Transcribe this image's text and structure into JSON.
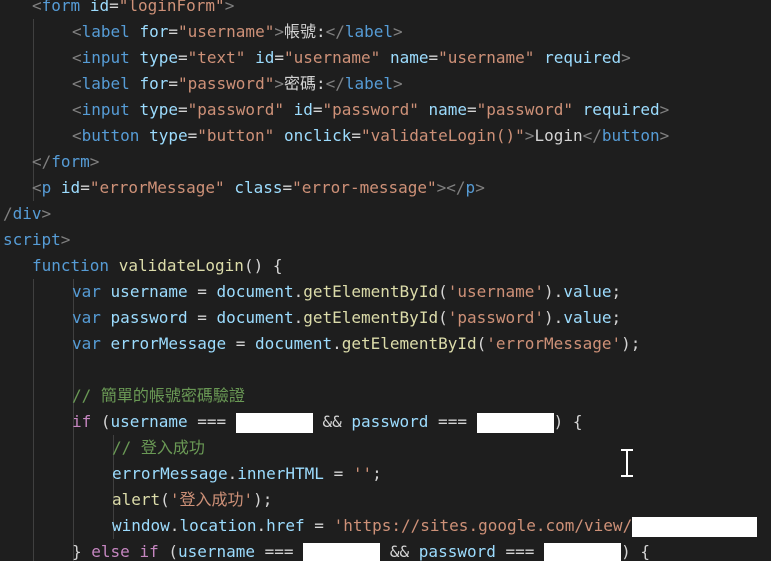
{
  "editor": {
    "language": "html",
    "redaction_color": "#ffffff",
    "cursor_icon": "text-cursor-icon",
    "lines": [
      {
        "indent": 32,
        "tokens": [
          {
            "t": "<",
            "c": "punc"
          },
          {
            "t": "form",
            "c": "tag"
          },
          {
            "t": " "
          },
          {
            "t": "id",
            "c": "attr"
          },
          {
            "t": "=",
            "c": "text"
          },
          {
            "t": "\"loginForm\"",
            "c": "str"
          },
          {
            "t": ">",
            "c": "punc"
          }
        ]
      },
      {
        "indent": 72,
        "tokens": [
          {
            "t": "<",
            "c": "punc"
          },
          {
            "t": "label",
            "c": "tag"
          },
          {
            "t": " "
          },
          {
            "t": "for",
            "c": "attr"
          },
          {
            "t": "=",
            "c": "text"
          },
          {
            "t": "\"username\"",
            "c": "str"
          },
          {
            "t": ">",
            "c": "punc"
          },
          {
            "t": "帳號:",
            "c": "text"
          },
          {
            "t": "</",
            "c": "punc"
          },
          {
            "t": "label",
            "c": "tag"
          },
          {
            "t": ">",
            "c": "punc"
          }
        ]
      },
      {
        "indent": 72,
        "tokens": [
          {
            "t": "<",
            "c": "punc"
          },
          {
            "t": "input",
            "c": "tag"
          },
          {
            "t": " "
          },
          {
            "t": "type",
            "c": "attr"
          },
          {
            "t": "=",
            "c": "text"
          },
          {
            "t": "\"text\"",
            "c": "str"
          },
          {
            "t": " "
          },
          {
            "t": "id",
            "c": "attr"
          },
          {
            "t": "=",
            "c": "text"
          },
          {
            "t": "\"username\"",
            "c": "str"
          },
          {
            "t": " "
          },
          {
            "t": "name",
            "c": "attr"
          },
          {
            "t": "=",
            "c": "text"
          },
          {
            "t": "\"username\"",
            "c": "str"
          },
          {
            "t": " "
          },
          {
            "t": "required",
            "c": "attr"
          },
          {
            "t": ">",
            "c": "punc"
          }
        ]
      },
      {
        "indent": 72,
        "tokens": [
          {
            "t": "<",
            "c": "punc"
          },
          {
            "t": "label",
            "c": "tag"
          },
          {
            "t": " "
          },
          {
            "t": "for",
            "c": "attr"
          },
          {
            "t": "=",
            "c": "text"
          },
          {
            "t": "\"password\"",
            "c": "str"
          },
          {
            "t": ">",
            "c": "punc"
          },
          {
            "t": "密碼:",
            "c": "text"
          },
          {
            "t": "</",
            "c": "punc"
          },
          {
            "t": "label",
            "c": "tag"
          },
          {
            "t": ">",
            "c": "punc"
          }
        ]
      },
      {
        "indent": 72,
        "tokens": [
          {
            "t": "<",
            "c": "punc"
          },
          {
            "t": "input",
            "c": "tag"
          },
          {
            "t": " "
          },
          {
            "t": "type",
            "c": "attr"
          },
          {
            "t": "=",
            "c": "text"
          },
          {
            "t": "\"password\"",
            "c": "str"
          },
          {
            "t": " "
          },
          {
            "t": "id",
            "c": "attr"
          },
          {
            "t": "=",
            "c": "text"
          },
          {
            "t": "\"password\"",
            "c": "str"
          },
          {
            "t": " "
          },
          {
            "t": "name",
            "c": "attr"
          },
          {
            "t": "=",
            "c": "text"
          },
          {
            "t": "\"password\"",
            "c": "str"
          },
          {
            "t": " "
          },
          {
            "t": "required",
            "c": "attr"
          },
          {
            "t": ">",
            "c": "punc"
          }
        ]
      },
      {
        "indent": 72,
        "tokens": [
          {
            "t": "<",
            "c": "punc"
          },
          {
            "t": "button",
            "c": "tag"
          },
          {
            "t": " "
          },
          {
            "t": "type",
            "c": "attr"
          },
          {
            "t": "=",
            "c": "text"
          },
          {
            "t": "\"button\"",
            "c": "str"
          },
          {
            "t": " "
          },
          {
            "t": "onclick",
            "c": "attr"
          },
          {
            "t": "=",
            "c": "text"
          },
          {
            "t": "\"validateLogin()\"",
            "c": "str"
          },
          {
            "t": ">",
            "c": "punc"
          },
          {
            "t": "Login",
            "c": "text"
          },
          {
            "t": "</",
            "c": "punc"
          },
          {
            "t": "button",
            "c": "tag"
          },
          {
            "t": ">",
            "c": "punc"
          }
        ]
      },
      {
        "indent": 32,
        "tokens": [
          {
            "t": "</",
            "c": "punc"
          },
          {
            "t": "form",
            "c": "tag"
          },
          {
            "t": ">",
            "c": "punc"
          }
        ]
      },
      {
        "indent": 32,
        "tokens": [
          {
            "t": "<",
            "c": "punc"
          },
          {
            "t": "p",
            "c": "tag"
          },
          {
            "t": " "
          },
          {
            "t": "id",
            "c": "attr"
          },
          {
            "t": "=",
            "c": "text"
          },
          {
            "t": "\"errorMessage\"",
            "c": "str"
          },
          {
            "t": " "
          },
          {
            "t": "class",
            "c": "attr"
          },
          {
            "t": "=",
            "c": "text"
          },
          {
            "t": "\"error-message\"",
            "c": "str"
          },
          {
            "t": "></",
            "c": "punc"
          },
          {
            "t": "p",
            "c": "tag"
          },
          {
            "t": ">",
            "c": "punc"
          }
        ]
      },
      {
        "indent": 3,
        "tokens": [
          {
            "t": "/",
            "c": "punc"
          },
          {
            "t": "div",
            "c": "tag"
          },
          {
            "t": ">",
            "c": "punc"
          }
        ]
      },
      {
        "indent": 3,
        "tokens": [
          {
            "t": "script",
            "c": "tag"
          },
          {
            "t": ">",
            "c": "punc"
          }
        ]
      },
      {
        "indent": 32,
        "tokens": [
          {
            "t": "function",
            "c": "kw"
          },
          {
            "t": " "
          },
          {
            "t": "validateLogin",
            "c": "fn"
          },
          {
            "t": "() {",
            "c": "text"
          }
        ]
      },
      {
        "indent": 72,
        "tokens": [
          {
            "t": "var",
            "c": "kw"
          },
          {
            "t": " "
          },
          {
            "t": "username",
            "c": "var"
          },
          {
            "t": " = ",
            "c": "text"
          },
          {
            "t": "document",
            "c": "var"
          },
          {
            "t": ".",
            "c": "text"
          },
          {
            "t": "getElementById",
            "c": "fn"
          },
          {
            "t": "(",
            "c": "text"
          },
          {
            "t": "'username'",
            "c": "str"
          },
          {
            "t": ").",
            "c": "text"
          },
          {
            "t": "value",
            "c": "var"
          },
          {
            "t": ";",
            "c": "text"
          }
        ]
      },
      {
        "indent": 72,
        "tokens": [
          {
            "t": "var",
            "c": "kw"
          },
          {
            "t": " "
          },
          {
            "t": "password",
            "c": "var"
          },
          {
            "t": " = ",
            "c": "text"
          },
          {
            "t": "document",
            "c": "var"
          },
          {
            "t": ".",
            "c": "text"
          },
          {
            "t": "getElementById",
            "c": "fn"
          },
          {
            "t": "(",
            "c": "text"
          },
          {
            "t": "'password'",
            "c": "str"
          },
          {
            "t": ").",
            "c": "text"
          },
          {
            "t": "value",
            "c": "var"
          },
          {
            "t": ";",
            "c": "text"
          }
        ]
      },
      {
        "indent": 72,
        "tokens": [
          {
            "t": "var",
            "c": "kw"
          },
          {
            "t": " "
          },
          {
            "t": "errorMessage",
            "c": "var"
          },
          {
            "t": " = ",
            "c": "text"
          },
          {
            "t": "document",
            "c": "var"
          },
          {
            "t": ".",
            "c": "text"
          },
          {
            "t": "getElementById",
            "c": "fn"
          },
          {
            "t": "(",
            "c": "text"
          },
          {
            "t": "'errorMessage'",
            "c": "str"
          },
          {
            "t": ");",
            "c": "text"
          }
        ]
      },
      {
        "indent": 72,
        "tokens": []
      },
      {
        "indent": 72,
        "tokens": [
          {
            "t": "// 簡單的帳號密碼驗證",
            "c": "cmt"
          }
        ]
      },
      {
        "indent": 72,
        "tokens": [
          {
            "t": "if",
            "c": "ctrl"
          },
          {
            "t": " (",
            "c": "text"
          },
          {
            "t": "username",
            "c": "var"
          },
          {
            "t": " === ",
            "c": "text"
          },
          {
            "t": "        ",
            "c": "redact"
          },
          {
            "t": " && ",
            "c": "text"
          },
          {
            "t": "password",
            "c": "var"
          },
          {
            "t": " === ",
            "c": "text"
          },
          {
            "t": "        ",
            "c": "redact"
          },
          {
            "t": ") {",
            "c": "text"
          }
        ]
      },
      {
        "indent": 112,
        "tokens": [
          {
            "t": "// 登入成功",
            "c": "cmt"
          }
        ]
      },
      {
        "indent": 112,
        "tokens": [
          {
            "t": "errorMessage",
            "c": "var"
          },
          {
            "t": ".",
            "c": "text"
          },
          {
            "t": "innerHTML",
            "c": "var"
          },
          {
            "t": " = ",
            "c": "text"
          },
          {
            "t": "''",
            "c": "str"
          },
          {
            "t": ";",
            "c": "text"
          }
        ]
      },
      {
        "indent": 112,
        "tokens": [
          {
            "t": "alert",
            "c": "fn"
          },
          {
            "t": "(",
            "c": "text"
          },
          {
            "t": "'登入成功'",
            "c": "str"
          },
          {
            "t": ");",
            "c": "text"
          }
        ]
      },
      {
        "indent": 112,
        "tokens": [
          {
            "t": "window",
            "c": "var"
          },
          {
            "t": ".",
            "c": "text"
          },
          {
            "t": "location",
            "c": "var"
          },
          {
            "t": ".",
            "c": "text"
          },
          {
            "t": "href",
            "c": "var"
          },
          {
            "t": " = ",
            "c": "text"
          },
          {
            "t": "'https://sites.google.com/view/",
            "c": "str"
          },
          {
            "t": "             ",
            "c": "redact"
          }
        ]
      },
      {
        "indent": 72,
        "tokens": [
          {
            "t": "} ",
            "c": "text"
          },
          {
            "t": "else",
            "c": "ctrl"
          },
          {
            "t": " "
          },
          {
            "t": "if",
            "c": "ctrl"
          },
          {
            "t": " (",
            "c": "text"
          },
          {
            "t": "username",
            "c": "var"
          },
          {
            "t": " === ",
            "c": "text"
          },
          {
            "t": "        ",
            "c": "redact"
          },
          {
            "t": " && ",
            "c": "text"
          },
          {
            "t": "password",
            "c": "var"
          },
          {
            "t": " === ",
            "c": "text"
          },
          {
            "t": "        ",
            "c": "redact"
          },
          {
            "t": ") {",
            "c": "text"
          }
        ]
      }
    ]
  }
}
